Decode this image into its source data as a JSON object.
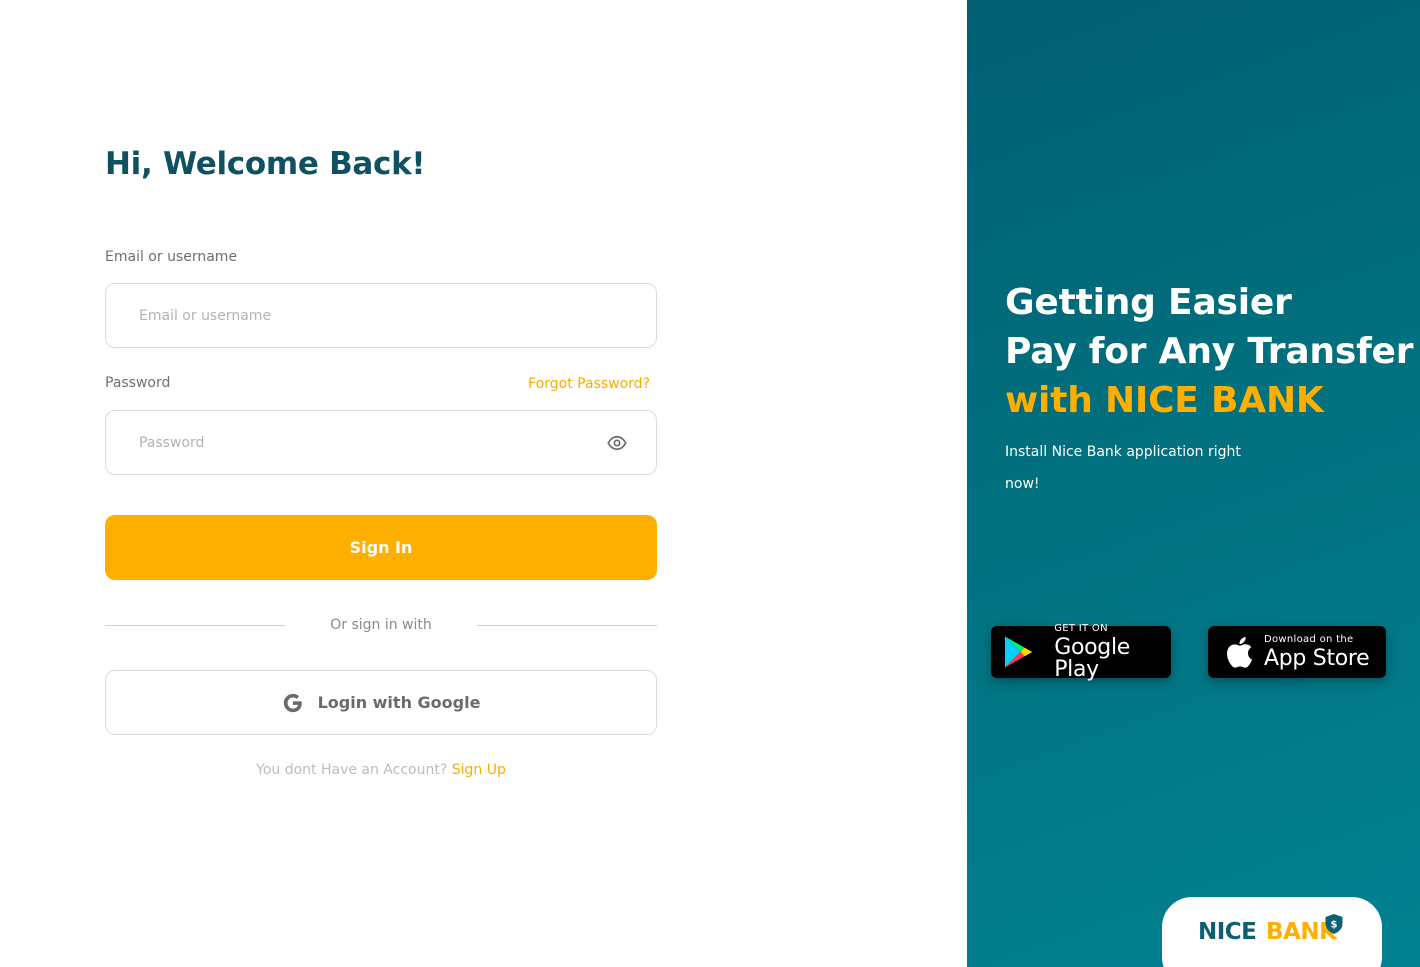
{
  "login": {
    "heading": "Hi, Welcome Back!",
    "email_label": "Email or username",
    "email_placeholder": "Email or username",
    "email_value": "",
    "password_label": "Password",
    "forgot_link": "Forgot Password?",
    "password_placeholder": "Password",
    "password_value": "",
    "password_toggle_icon": "eye-icon",
    "signin_label": "Sign In",
    "divider_text": "Or sign in with",
    "google_label": "Login with Google",
    "google_icon": "google-g-icon",
    "signup_prompt": "You dont Have an Account?",
    "signup_link": "Sign Up"
  },
  "promo": {
    "headline_line1": "Getting Easier",
    "headline_line2": "Pay for Any Transfer",
    "headline_line3": "with NICE BANK",
    "subtext": "Install Nice Bank application right now!",
    "google_play": {
      "small": "GET IT ON",
      "big": "Google Play",
      "icon": "google-play-icon"
    },
    "app_store": {
      "small": "Download on the",
      "big": "App Store",
      "icon": "apple-icon"
    }
  },
  "brand": {
    "name_part1": "NICE",
    "name_part2": "BANK",
    "logo_icon": "shield-dollar-icon"
  },
  "colors": {
    "primary": "#feaf00",
    "heading": "#0f5061",
    "panel_start": "#005f72",
    "panel_end": "#018190"
  }
}
